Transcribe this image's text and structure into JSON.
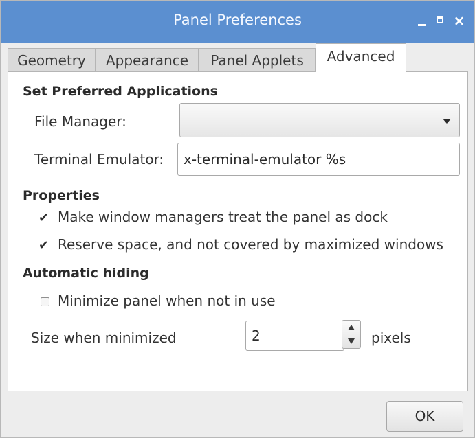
{
  "window": {
    "title": "Panel Preferences",
    "controls": {
      "minimize": "_",
      "maximize": "□",
      "close": "×"
    }
  },
  "tabs": [
    {
      "label": "Geometry",
      "active": false
    },
    {
      "label": "Appearance",
      "active": false
    },
    {
      "label": "Panel Applets",
      "active": false
    },
    {
      "label": "Advanced",
      "active": true
    }
  ],
  "preferred_apps": {
    "heading": "Set Preferred Applications",
    "file_manager_label": "File Manager:",
    "file_manager_value": "",
    "terminal_label": "Terminal Emulator:",
    "terminal_value": "x-terminal-emulator %s"
  },
  "properties": {
    "heading": "Properties",
    "dock_label": "Make window managers treat the panel as dock",
    "dock_checked": true,
    "reserve_label": "Reserve space, and not covered by maximized windows",
    "reserve_checked": true
  },
  "auto_hide": {
    "heading": "Automatic hiding",
    "minimize_label": "Minimize panel when not in use",
    "minimize_checked": false,
    "size_label": "Size when minimized",
    "size_value": "2",
    "size_unit": "pixels"
  },
  "buttons": {
    "ok": "OK"
  },
  "colors": {
    "titlebar": "#5b8fd0",
    "background": "#ededed"
  }
}
